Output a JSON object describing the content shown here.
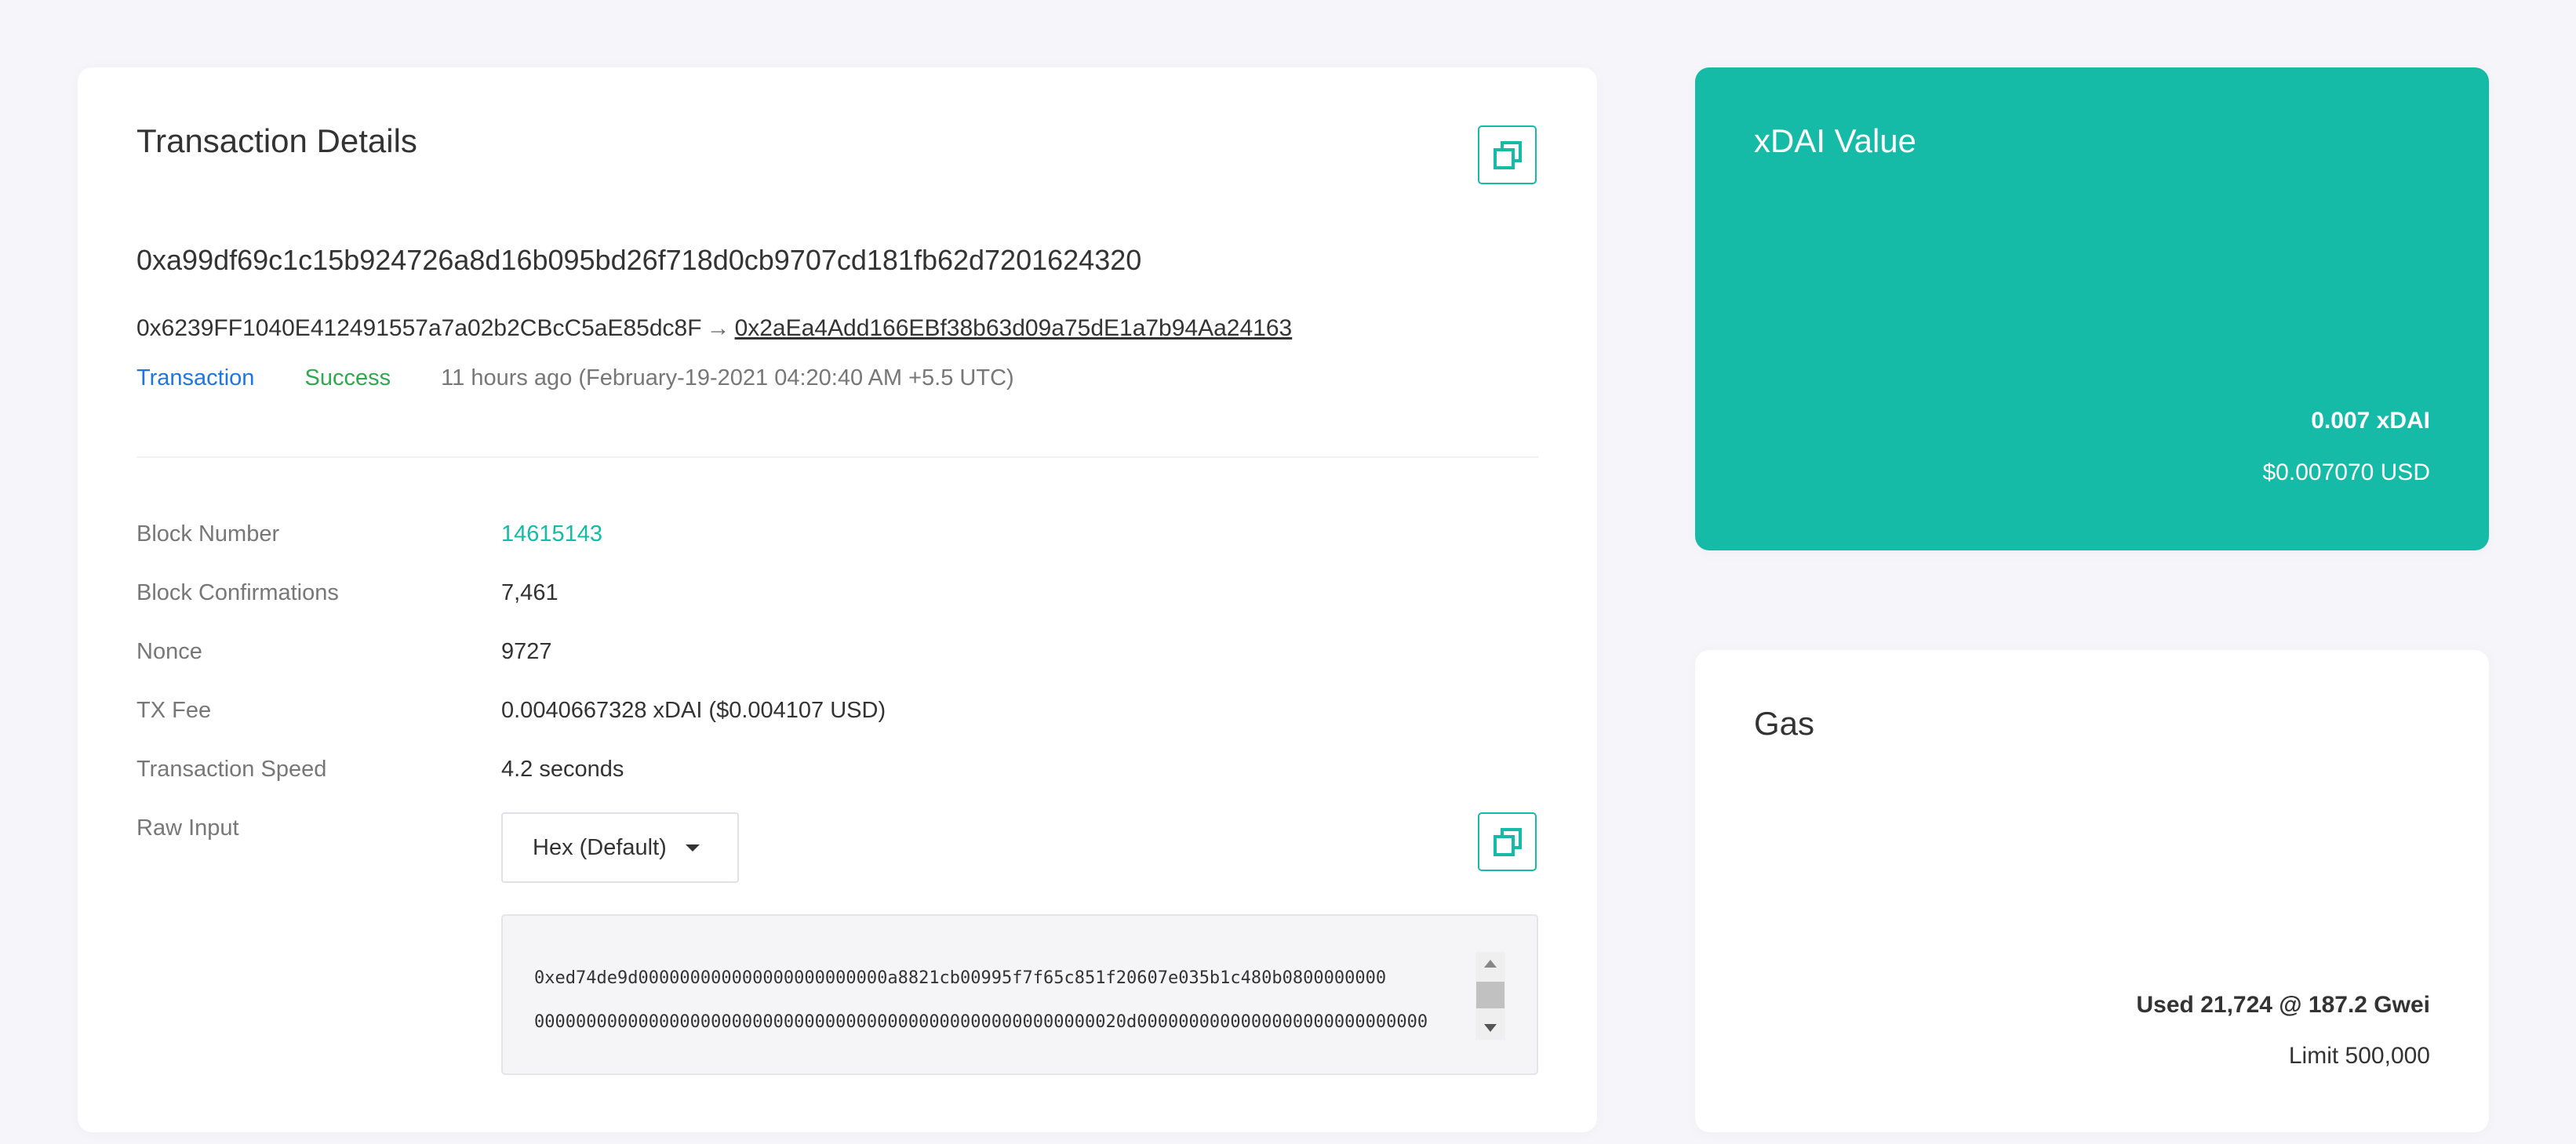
{
  "details": {
    "title": "Transaction Details",
    "copy_icon": "copy-icon",
    "hash": "0xa99df69c1c15b924726a8d16b095bd26f718d0cb9707cd181fb62d7201624320",
    "from": "0x6239FF1040E412491557a7a02b2CBcC5aE85dc8F",
    "arrow": "→",
    "to": "0x2aEa4Add166EBf38b63d09a75dE1a7b94Aa24163",
    "type": "Transaction",
    "status": "Success",
    "status_color": "#2fa84f",
    "time": "11 hours ago (February-19-2021 04:20:40 AM +5.5 UTC)",
    "rows": [
      {
        "label": "Block Number",
        "value": "14615143"
      },
      {
        "label": "Block Confirmations",
        "value": "7,461"
      },
      {
        "label": "Nonce",
        "value": "9727"
      },
      {
        "label": "TX Fee",
        "value": "0.0040667328 xDAI ($0.004107 USD)"
      },
      {
        "label": "Transaction Speed",
        "value": "4.2 seconds"
      }
    ],
    "raw_input": {
      "label": "Raw Input",
      "format_selected": "Hex (Default)",
      "lines": [
        "0xed74de9d000000000000000000000000a8821cb00995f7f65c851f20607e035b1c480b0800000000",
        "000000000000000000000000000000000000000000000000000000020d0000000000000000000000000000"
      ]
    }
  },
  "value_card": {
    "title": "xDAI Value",
    "amount": "0.007 xDAI",
    "usd": "$0.007070 USD",
    "color": "#15bba6"
  },
  "gas_card": {
    "title": "Gas",
    "used": "Used 21,724 @ 187.2 Gwei",
    "limit": "Limit 500,000"
  }
}
